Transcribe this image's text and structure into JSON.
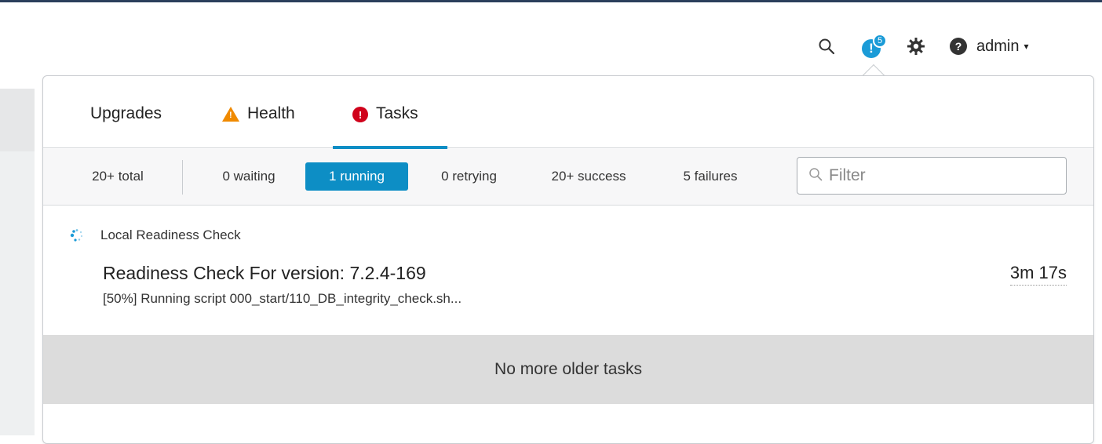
{
  "header": {
    "notification_count": "5",
    "notification_glyph": "!",
    "help_glyph": "?",
    "user_label": "admin",
    "caret": "▾"
  },
  "tabs": [
    {
      "label": "Upgrades",
      "icon": "none"
    },
    {
      "label": "Health",
      "icon": "warning-triangle-icon"
    },
    {
      "label": "Tasks",
      "icon": "error-circle-icon",
      "active": true
    }
  ],
  "filters": {
    "total": "20+ total",
    "waiting": "0 waiting",
    "running": "1 running",
    "retrying": "0 retrying",
    "success": "20+ success",
    "failures": "5 failures",
    "search_placeholder": "Filter"
  },
  "task": {
    "category": "Local Readiness Check",
    "title": "Readiness Check For version: 7.2.4-169",
    "detail": "[50%] Running script 000_start/110_DB_integrity_check.sh...",
    "elapsed": "3m 17s",
    "status": "running"
  },
  "footer": {
    "no_more_label": "No more older tasks"
  },
  "colors": {
    "accent": "#0d8ec5",
    "notification": "#1b9bd7",
    "warning": "#f08a00",
    "error": "#d0021b"
  }
}
